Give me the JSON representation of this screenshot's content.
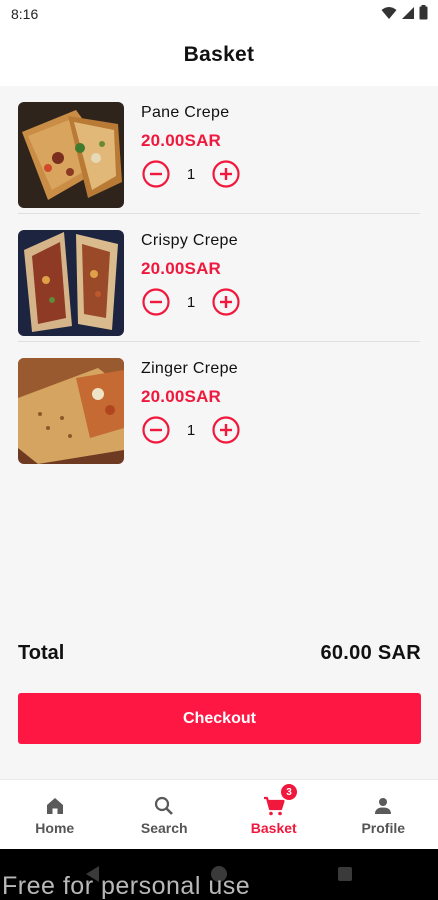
{
  "status_bar": {
    "time": "8:16"
  },
  "header": {
    "title": "Basket"
  },
  "items": [
    {
      "name": "Pane Crepe",
      "price": "20.00SAR",
      "quantity": "1"
    },
    {
      "name": "Crispy Crepe",
      "price": "20.00SAR",
      "quantity": "1"
    },
    {
      "name": "Zinger Crepe",
      "price": "20.00SAR",
      "quantity": "1"
    }
  ],
  "summary": {
    "total_label": "Total",
    "total_value": "60.00 SAR"
  },
  "checkout": {
    "label": "Checkout"
  },
  "bottom_nav": {
    "items": [
      {
        "label": "Home",
        "icon": "home-icon"
      },
      {
        "label": "Search",
        "icon": "search-icon"
      },
      {
        "label": "Basket",
        "icon": "cart-icon",
        "active": true
      },
      {
        "label": "Profile",
        "icon": "person-icon"
      }
    ],
    "badge": "3"
  },
  "watermark": "Free for personal use",
  "colors": {
    "accent": "#f0183c",
    "button": "#ff1744",
    "background": "#f6f6f6"
  }
}
